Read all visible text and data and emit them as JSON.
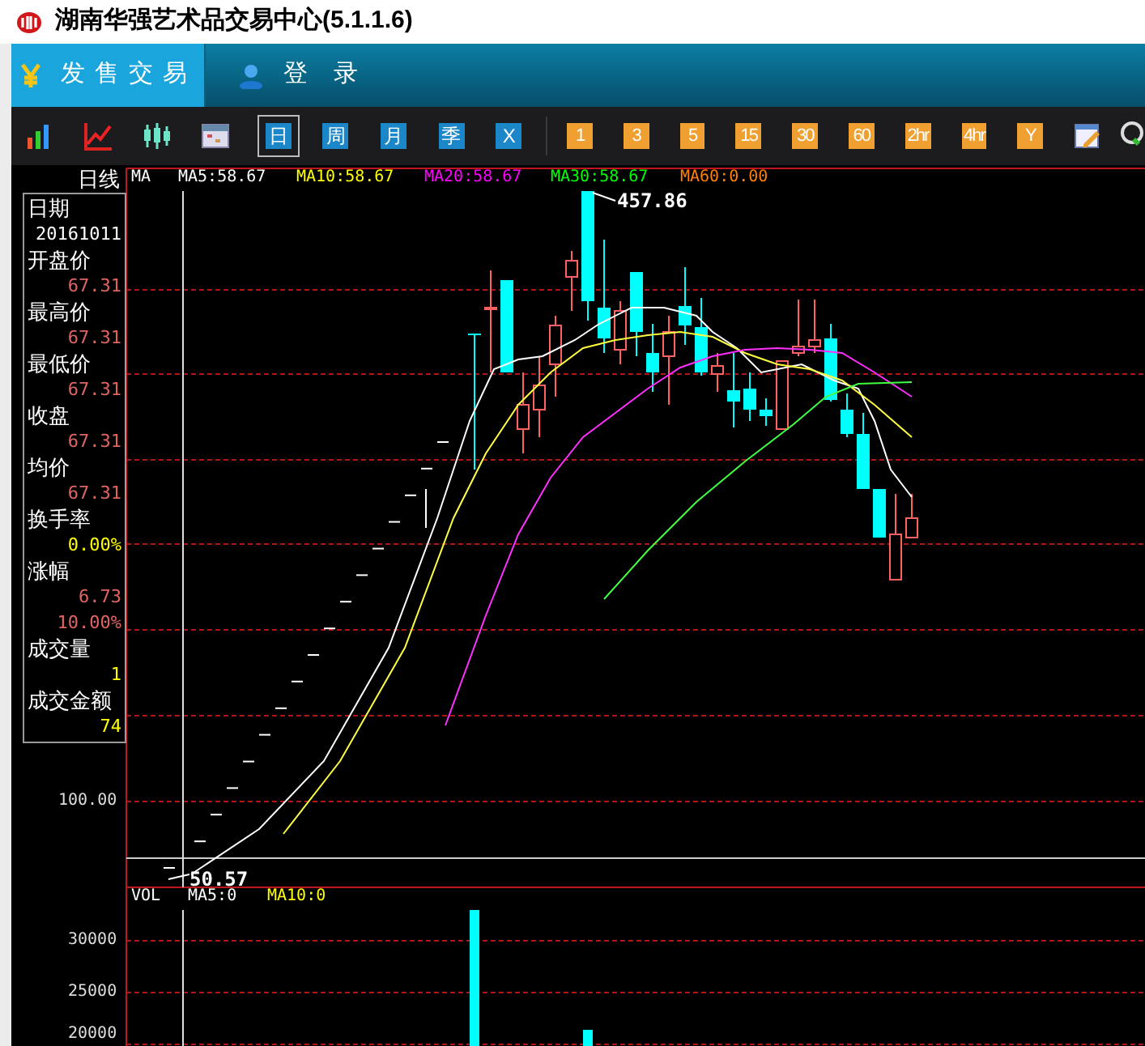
{
  "window": {
    "title": "湖南华强艺术品交易中心(5.1.1.6)"
  },
  "nav_tabs": [
    {
      "label": "发售交易",
      "selected": true,
      "kind": "yen"
    },
    {
      "label": "登 录",
      "selected": false,
      "kind": "user"
    }
  ],
  "toolbar": {
    "period_buttons": [
      {
        "label": "日",
        "selected": true
      },
      {
        "label": "周",
        "selected": false
      },
      {
        "label": "月",
        "selected": false
      },
      {
        "label": "季",
        "selected": false
      },
      {
        "label": "X",
        "selected": false
      }
    ],
    "minute_buttons": [
      "1",
      "3",
      "5",
      "15",
      "30",
      "60",
      "2hr",
      "4hr",
      "Y"
    ]
  },
  "chart": {
    "period_label": "日线",
    "legend": [
      {
        "text": "MA",
        "color": "#ffffff"
      },
      {
        "text": "MA5:58.67",
        "color": "#ffffff"
      },
      {
        "text": "MA10:58.67",
        "color": "#ffff00"
      },
      {
        "text": "MA20:58.67",
        "color": "#ff00ff"
      },
      {
        "text": "MA30:58.67",
        "color": "#00ff00"
      },
      {
        "text": "MA60:0.00",
        "color": "#ff8000"
      }
    ],
    "info_panel": [
      {
        "label": "日期",
        "values": [
          {
            "text": "20161011",
            "color": "#ffffff"
          }
        ]
      },
      {
        "label": "开盘价",
        "values": [
          {
            "text": "67.31",
            "color": "#e06464"
          }
        ]
      },
      {
        "label": "最高价",
        "values": [
          {
            "text": "67.31",
            "color": "#e06464"
          }
        ]
      },
      {
        "label": "最低价",
        "values": [
          {
            "text": "67.31",
            "color": "#e06464"
          }
        ]
      },
      {
        "label": "收盘",
        "values": [
          {
            "text": "67.31",
            "color": "#e06464"
          }
        ]
      },
      {
        "label": "均价",
        "values": [
          {
            "text": "67.31",
            "color": "#e06464"
          }
        ]
      },
      {
        "label": "换手率",
        "values": [
          {
            "text": "0.00%",
            "color": "#ffff00"
          }
        ]
      },
      {
        "label": "涨幅",
        "values": [
          {
            "text": "6.73",
            "color": "#e06464"
          },
          {
            "text": "10.00%",
            "color": "#e06464"
          }
        ]
      },
      {
        "label": "成交量",
        "values": [
          {
            "text": "1",
            "color": "#ffff00"
          }
        ]
      },
      {
        "label": "成交金额",
        "values": [
          {
            "text": "74",
            "color": "#ffff00"
          }
        ]
      }
    ],
    "price_axis_label": "100.00",
    "high_marker": "457.86",
    "low_marker": "50.57",
    "volume_legend": [
      {
        "text": "VOL",
        "color": "#ffffff"
      },
      {
        "text": "MA5:0",
        "color": "#ffffff"
      },
      {
        "text": "MA10:0",
        "color": "#ffff00"
      }
    ],
    "volume_axis_labels": [
      "30000",
      "25000",
      "20000"
    ]
  }
}
